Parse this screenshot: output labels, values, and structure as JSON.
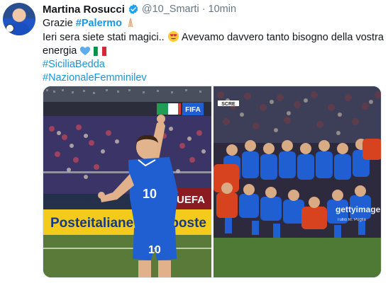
{
  "author": {
    "name": "Martina Rosucci",
    "handle": "@10_Smarti",
    "separator": "·",
    "time": "10min",
    "avatar_icon": "profile-photo"
  },
  "tweet": {
    "line1_prefix": "Grazie ",
    "line1_tag": "#Palermo",
    "line2_text": "Ieri sera siete stati magici.. ",
    "line2_rest": "Avevamo davvero tanto bisogno della vostra",
    "line3_text": "energia ",
    "hashtag1": "#SiciliaBedda",
    "hashtag2": "#NazionaleFemminilev"
  },
  "media": {
    "left_banner": "Posteitaliane",
    "left_banner_right": "poste",
    "left_ad": "UEFA",
    "left_fifa": "FIFA",
    "jersey_number": "10",
    "right_watermark": "gettyimages",
    "right_credit": "Tullio M. Puglia",
    "right_sign": "SCRE"
  },
  "colors": {
    "accent": "#1b95e0",
    "verified": "#1da1f2",
    "italy_blue": "#1f5fd1"
  }
}
